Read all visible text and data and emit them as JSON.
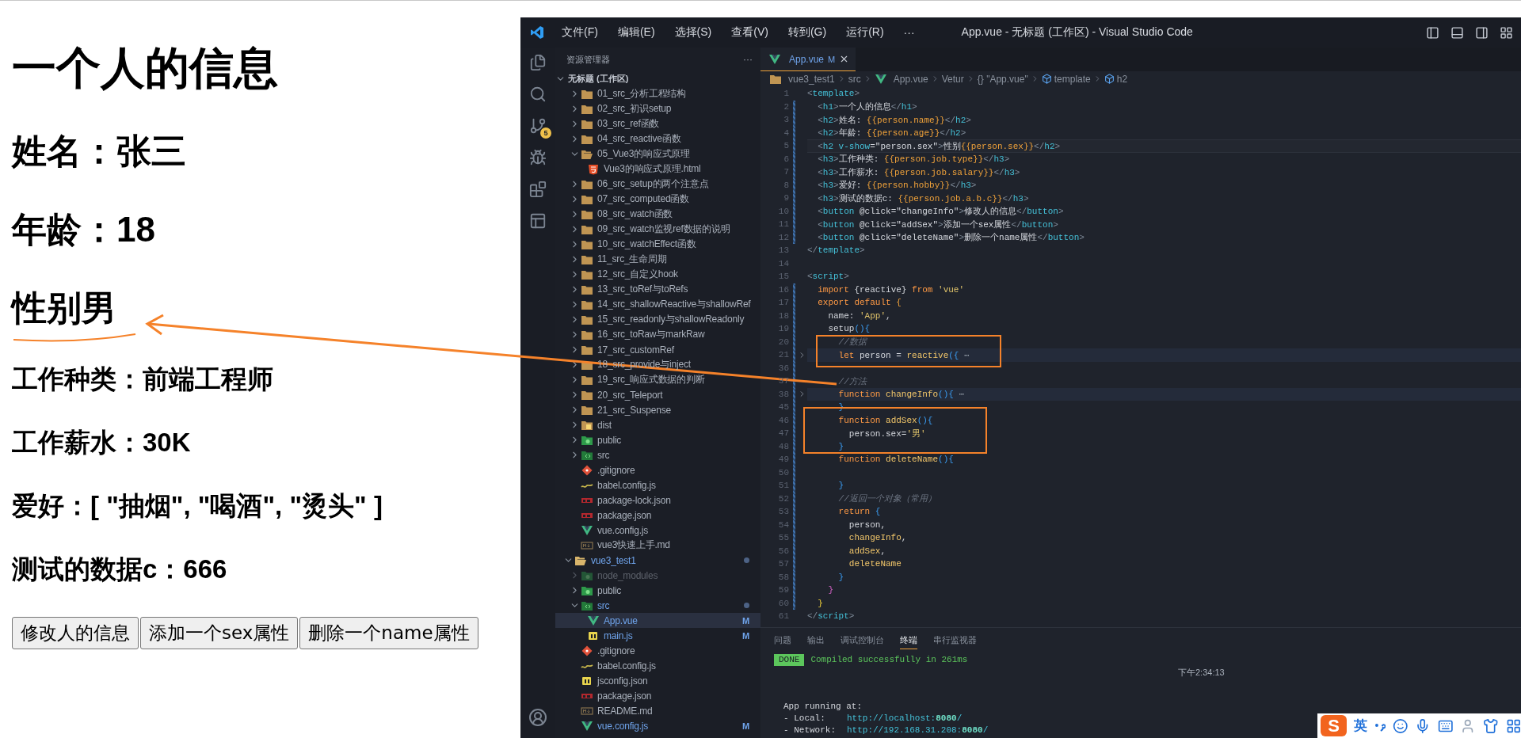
{
  "page": {
    "heading": "一个人的信息",
    "fields": [
      {
        "kind": "h2",
        "text": "姓名：张三"
      },
      {
        "kind": "h2",
        "text": "年龄：18"
      },
      {
        "kind": "h2",
        "text": "性别男"
      },
      {
        "kind": "h3",
        "text": "工作种类：前端工程师"
      },
      {
        "kind": "h3",
        "text": "工作薪水：30K"
      },
      {
        "kind": "h3",
        "text": "爱好：[ \"抽烟\", \"喝酒\", \"烫头\" ]"
      },
      {
        "kind": "h3",
        "text": "测试的数据c：666"
      }
    ],
    "buttons": [
      "修改人的信息",
      "添加一个sex属性",
      "删除一个name属性"
    ]
  },
  "vscode": {
    "title_bar": {
      "menus": [
        "文件(F)",
        "编辑(E)",
        "选择(S)",
        "查看(V)",
        "转到(G)",
        "运行(R)",
        "···"
      ],
      "title": "App.vue - 无标题 (工作区) - Visual Studio Code"
    },
    "activity_bar": {
      "scm_badge": "5"
    },
    "sidebar": {
      "title": "资源管理器",
      "more": "···",
      "workspace": {
        "label": "无标题 (工作区)",
        "expanded": true
      },
      "items": [
        {
          "label": "01_src_分析工程结构",
          "kind": "folder",
          "expanded": false,
          "selected": false,
          "modified": false,
          "ignored": false
        },
        {
          "label": "02_src_初识setup",
          "kind": "folder",
          "expanded": false,
          "selected": false,
          "modified": false,
          "ignored": false
        },
        {
          "label": "03_src_ref函数",
          "kind": "folder",
          "expanded": false,
          "selected": false,
          "modified": false,
          "ignored": false
        },
        {
          "label": "04_src_reactive函数",
          "kind": "folder",
          "expanded": false,
          "selected": false,
          "modified": false,
          "ignored": false
        },
        {
          "label": "05_Vue3的响应式原理",
          "kind": "folder",
          "expanded": true,
          "selected": false,
          "modified": false,
          "ignored": false,
          "children": [
            {
              "label": "Vue3的响应式原理.html",
              "kind": "html",
              "selected": false,
              "modified": false,
              "ignored": false
            }
          ]
        },
        {
          "label": "06_src_setup的两个注意点",
          "kind": "folder",
          "expanded": false,
          "selected": false,
          "modified": false,
          "ignored": false
        },
        {
          "label": "07_src_computed函数",
          "kind": "folder",
          "expanded": false,
          "selected": false,
          "modified": false,
          "ignored": false
        },
        {
          "label": "08_src_watch函数",
          "kind": "folder",
          "expanded": false,
          "selected": false,
          "modified": false,
          "ignored": false
        },
        {
          "label": "09_src_watch监视ref数据的说明",
          "kind": "folder",
          "expanded": false,
          "selected": false,
          "modified": false,
          "ignored": false
        },
        {
          "label": "10_src_watchEffect函数",
          "kind": "folder",
          "expanded": false,
          "selected": false,
          "modified": false,
          "ignored": false
        },
        {
          "label": "11_src_生命周期",
          "kind": "folder",
          "expanded": false,
          "selected": false,
          "modified": false,
          "ignored": false
        },
        {
          "label": "12_src_自定义hook",
          "kind": "folder",
          "expanded": false,
          "selected": false,
          "modified": false,
          "ignored": false
        },
        {
          "label": "13_src_toRef与toRefs",
          "kind": "folder",
          "expanded": false,
          "selected": false,
          "modified": false,
          "ignored": false
        },
        {
          "label": "14_src_shallowReactive与shallowRef",
          "kind": "folder",
          "expanded": false,
          "selected": false,
          "modified": false,
          "ignored": false
        },
        {
          "label": "15_src_readonly与shallowReadonly",
          "kind": "folder",
          "expanded": false,
          "selected": false,
          "modified": false,
          "ignored": false
        },
        {
          "label": "16_src_toRaw与markRaw",
          "kind": "folder",
          "expanded": false,
          "selected": false,
          "modified": false,
          "ignored": false
        },
        {
          "label": "17_src_customRef",
          "kind": "folder",
          "expanded": false,
          "selected": false,
          "modified": false,
          "ignored": false
        },
        {
          "label": "18_src_provide与inject",
          "kind": "folder",
          "expanded": false,
          "selected": false,
          "modified": false,
          "ignored": false
        },
        {
          "label": "19_src_响应式数据的判断",
          "kind": "folder",
          "expanded": false,
          "selected": false,
          "modified": false,
          "ignored": false
        },
        {
          "label": "20_src_Teleport",
          "kind": "folder",
          "expanded": false,
          "selected": false,
          "modified": false,
          "ignored": false
        },
        {
          "label": "21_src_Suspense",
          "kind": "folder",
          "expanded": false,
          "selected": false,
          "modified": false,
          "ignored": false
        },
        {
          "label": "dist",
          "kind": "dist-folder",
          "expanded": false,
          "selected": false,
          "modified": false,
          "ignored": false
        },
        {
          "label": "public",
          "kind": "public-folder",
          "expanded": false,
          "selected": false,
          "modified": false,
          "ignored": false
        },
        {
          "label": "src",
          "kind": "source-folder",
          "expanded": false,
          "selected": false,
          "modified": false,
          "ignored": false
        },
        {
          "label": ".gitignore",
          "kind": "git",
          "selected": false,
          "modified": false,
          "ignored": false
        },
        {
          "label": "babel.config.js",
          "kind": "babel",
          "selected": false,
          "modified": false,
          "ignored": false
        },
        {
          "label": "package-lock.json",
          "kind": "npm",
          "selected": false,
          "modified": false,
          "ignored": false
        },
        {
          "label": "package.json",
          "kind": "npm",
          "selected": false,
          "modified": false,
          "ignored": false
        },
        {
          "label": "vue.config.js",
          "kind": "vue",
          "selected": false,
          "modified": false,
          "ignored": false
        },
        {
          "label": "vue3快速上手.md",
          "kind": "markdown",
          "selected": false,
          "modified": false,
          "ignored": false
        },
        {
          "label": "vue3_test1",
          "kind": "root",
          "expanded": true,
          "selected": false,
          "modified": true,
          "ignored": false,
          "dot": true,
          "children": [
            {
              "label": "node_modules",
              "kind": "public-folder",
              "expanded": false,
              "selected": false,
              "modified": false,
              "ignored": true
            },
            {
              "label": "public",
              "kind": "public-folder",
              "expanded": false,
              "selected": false,
              "modified": false,
              "ignored": false
            },
            {
              "label": "src",
              "kind": "source-folder",
              "expanded": true,
              "selected": false,
              "modified": true,
              "ignored": false,
              "dot": true,
              "children": [
                {
                  "label": "App.vue",
                  "kind": "vue",
                  "selected": true,
                  "modified": true,
                  "ignored": false,
                  "badge": "M"
                },
                {
                  "label": "main.js",
                  "kind": "js",
                  "selected": false,
                  "modified": true,
                  "ignored": false,
                  "badge": "M"
                }
              ]
            },
            {
              "label": ".gitignore",
              "kind": "git",
              "selected": false,
              "modified": false,
              "ignored": false
            },
            {
              "label": "babel.config.js",
              "kind": "babel",
              "selected": false,
              "modified": false,
              "ignored": false
            },
            {
              "label": "jsconfig.json",
              "kind": "js",
              "selected": false,
              "modified": false,
              "ignored": false
            },
            {
              "label": "package.json",
              "kind": "npm",
              "selected": false,
              "modified": false,
              "ignored": false
            },
            {
              "label": "README.md",
              "kind": "markdown",
              "selected": false,
              "modified": false,
              "ignored": false
            },
            {
              "label": "vue.config.js",
              "kind": "vue",
              "selected": false,
              "modified": true,
              "ignored": false,
              "badge": "M"
            }
          ]
        }
      ]
    },
    "tabs": [
      {
        "label": "App.vue",
        "badge": "M",
        "selected": true
      }
    ],
    "breadcrumb": [
      {
        "label": "vue3_test1",
        "kind": "folder"
      },
      {
        "label": "src",
        "kind": "plain"
      },
      {
        "label": "App.vue",
        "kind": "vue"
      },
      {
        "label": "Vetur",
        "kind": "plain"
      },
      {
        "label": "{} \"App.vue\"",
        "kind": "plain"
      },
      {
        "label": "template",
        "kind": "element"
      },
      {
        "label": "h2",
        "kind": "element"
      }
    ],
    "code": [
      {
        "n": "1",
        "kind": "plain",
        "changed": false,
        "segs": [
          {
            "kind": "punct",
            "text": "<"
          },
          {
            "kind": "tag",
            "text": "template"
          },
          {
            "kind": "punct",
            "text": ">"
          }
        ]
      },
      {
        "n": "2",
        "kind": "plain",
        "changed": true,
        "segs": [
          {
            "kind": "punct",
            "text": "  <"
          },
          {
            "kind": "tag",
            "text": "h1"
          },
          {
            "kind": "punct",
            "text": ">"
          },
          {
            "kind": "text",
            "text": "一个人的信息"
          },
          {
            "kind": "punct",
            "text": "</"
          },
          {
            "kind": "tag",
            "text": "h1"
          },
          {
            "kind": "punct",
            "text": ">"
          }
        ]
      },
      {
        "n": "3",
        "kind": "plain",
        "changed": true,
        "segs": [
          {
            "kind": "punct",
            "text": "  <"
          },
          {
            "kind": "tag",
            "text": "h2"
          },
          {
            "kind": "punct",
            "text": ">"
          },
          {
            "kind": "text",
            "text": "姓名: "
          },
          {
            "kind": "interp",
            "text": "{{person.name}}"
          },
          {
            "kind": "punct",
            "text": "</"
          },
          {
            "kind": "tag",
            "text": "h2"
          },
          {
            "kind": "punct",
            "text": ">"
          }
        ]
      },
      {
        "n": "4",
        "kind": "plain",
        "changed": true,
        "segs": [
          {
            "kind": "punct",
            "text": "  <"
          },
          {
            "kind": "tag",
            "text": "h2"
          },
          {
            "kind": "punct",
            "text": ">"
          },
          {
            "kind": "text",
            "text": "年龄: "
          },
          {
            "kind": "interp",
            "text": "{{person.age}}"
          },
          {
            "kind": "punct",
            "text": "</"
          },
          {
            "kind": "tag",
            "text": "h2"
          },
          {
            "kind": "punct",
            "text": ">"
          }
        ]
      },
      {
        "n": "5",
        "kind": "current",
        "changed": true,
        "segs": [
          {
            "kind": "punct",
            "text": "  <"
          },
          {
            "kind": "tag",
            "text": "h2 v-show"
          },
          {
            "kind": "text",
            "text": "=\"person.sex\""
          },
          {
            "kind": "punct",
            "text": ">"
          },
          {
            "kind": "text",
            "text": "性别"
          },
          {
            "kind": "interp",
            "text": "{{person.sex}}"
          },
          {
            "kind": "punct",
            "text": "</"
          },
          {
            "kind": "tag",
            "text": "h2"
          },
          {
            "kind": "punct",
            "text": ">"
          }
        ]
      },
      {
        "n": "6",
        "kind": "plain",
        "changed": true,
        "segs": [
          {
            "kind": "punct",
            "text": "  <"
          },
          {
            "kind": "tag",
            "text": "h3"
          },
          {
            "kind": "punct",
            "text": ">"
          },
          {
            "kind": "text",
            "text": "工作种类: "
          },
          {
            "kind": "interp",
            "text": "{{person.job.type}}"
          },
          {
            "kind": "punct",
            "text": "</"
          },
          {
            "kind": "tag",
            "text": "h3"
          },
          {
            "kind": "punct",
            "text": ">"
          }
        ]
      },
      {
        "n": "7",
        "kind": "plain",
        "changed": true,
        "segs": [
          {
            "kind": "punct",
            "text": "  <"
          },
          {
            "kind": "tag",
            "text": "h3"
          },
          {
            "kind": "punct",
            "text": ">"
          },
          {
            "kind": "text",
            "text": "工作薪水: "
          },
          {
            "kind": "interp",
            "text": "{{person.job.salary}}"
          },
          {
            "kind": "punct",
            "text": "</"
          },
          {
            "kind": "tag",
            "text": "h3"
          },
          {
            "kind": "punct",
            "text": ">"
          }
        ]
      },
      {
        "n": "8",
        "kind": "plain",
        "changed": true,
        "segs": [
          {
            "kind": "punct",
            "text": "  <"
          },
          {
            "kind": "tag",
            "text": "h3"
          },
          {
            "kind": "punct",
            "text": ">"
          },
          {
            "kind": "text",
            "text": "爱好: "
          },
          {
            "kind": "interp",
            "text": "{{person.hobby}}"
          },
          {
            "kind": "punct",
            "text": "</"
          },
          {
            "kind": "tag",
            "text": "h3"
          },
          {
            "kind": "punct",
            "text": ">"
          }
        ]
      },
      {
        "n": "9",
        "kind": "plain",
        "changed": true,
        "segs": [
          {
            "kind": "punct",
            "text": "  <"
          },
          {
            "kind": "tag",
            "text": "h3"
          },
          {
            "kind": "punct",
            "text": ">"
          },
          {
            "kind": "text",
            "text": "测试的数据c: "
          },
          {
            "kind": "interp",
            "text": "{{person.job.a.b.c}}"
          },
          {
            "kind": "punct",
            "text": "</"
          },
          {
            "kind": "tag",
            "text": "h3"
          },
          {
            "kind": "punct",
            "text": ">"
          }
        ]
      },
      {
        "n": "10",
        "kind": "plain",
        "changed": true,
        "segs": [
          {
            "kind": "punct",
            "text": "  <"
          },
          {
            "kind": "tag",
            "text": "button"
          },
          {
            "kind": "text",
            "text": " @click=\"changeInfo\""
          },
          {
            "kind": "punct",
            "text": ">"
          },
          {
            "kind": "text",
            "text": "修改人的信息"
          },
          {
            "kind": "punct",
            "text": "</"
          },
          {
            "kind": "tag",
            "text": "button"
          },
          {
            "kind": "punct",
            "text": ">"
          }
        ]
      },
      {
        "n": "11",
        "kind": "plain",
        "changed": true,
        "segs": [
          {
            "kind": "punct",
            "text": "  <"
          },
          {
            "kind": "tag",
            "text": "button"
          },
          {
            "kind": "text",
            "text": " @click=\"addSex\""
          },
          {
            "kind": "punct",
            "text": ">"
          },
          {
            "kind": "text",
            "text": "添加一个sex属性"
          },
          {
            "kind": "punct",
            "text": "</"
          },
          {
            "kind": "tag",
            "text": "button"
          },
          {
            "kind": "punct",
            "text": ">"
          }
        ]
      },
      {
        "n": "12",
        "kind": "plain",
        "changed": true,
        "segs": [
          {
            "kind": "punct",
            "text": "  <"
          },
          {
            "kind": "tag",
            "text": "button"
          },
          {
            "kind": "text",
            "text": " @click=\"deleteName\""
          },
          {
            "kind": "punct",
            "text": ">"
          },
          {
            "kind": "text",
            "text": "删除一个name属性"
          },
          {
            "kind": "punct",
            "text": "</"
          },
          {
            "kind": "tag",
            "text": "button"
          },
          {
            "kind": "punct",
            "text": ">"
          }
        ]
      },
      {
        "n": "13",
        "kind": "plain",
        "changed": false,
        "segs": [
          {
            "kind": "punct",
            "text": "</"
          },
          {
            "kind": "tag",
            "text": "template"
          },
          {
            "kind": "punct",
            "text": ">"
          }
        ]
      },
      {
        "n": "14",
        "kind": "plain",
        "changed": false
      },
      {
        "n": "15",
        "kind": "plain",
        "changed": false,
        "segs": [
          {
            "kind": "punct",
            "text": "<"
          },
          {
            "kind": "tag",
            "text": "script"
          },
          {
            "kind": "punct",
            "text": ">"
          }
        ]
      },
      {
        "n": "16",
        "kind": "plain",
        "changed": true,
        "segs": [
          {
            "kind": "kw",
            "text": "  import "
          },
          {
            "kind": "text",
            "text": "{reactive} "
          },
          {
            "kind": "kw",
            "text": "from "
          },
          {
            "kind": "string",
            "text": "'vue'"
          }
        ]
      },
      {
        "n": "17",
        "kind": "plain",
        "changed": true,
        "segs": [
          {
            "kind": "kw",
            "text": "  export default "
          },
          {
            "kind": "interp",
            "text": "{"
          }
        ]
      },
      {
        "n": "18",
        "kind": "plain",
        "changed": true,
        "segs": [
          {
            "kind": "text",
            "text": "    name: "
          },
          {
            "kind": "string",
            "text": "'App'"
          },
          {
            "kind": "text",
            "text": ","
          }
        ]
      },
      {
        "n": "19",
        "kind": "plain",
        "changed": true,
        "segs": [
          {
            "kind": "text",
            "text": "    setup"
          },
          {
            "kind": "bracket",
            "text": "(){"
          }
        ]
      },
      {
        "n": "20",
        "kind": "plain",
        "changed": true,
        "segs": [
          {
            "kind": "comment",
            "text": "      //数据"
          }
        ]
      },
      {
        "n": "21",
        "kind": "folded",
        "changed": true,
        "segs": [
          {
            "kind": "kw",
            "text": "      let "
          },
          {
            "kind": "text",
            "text": "person = "
          },
          {
            "kind": "fn",
            "text": "reactive"
          },
          {
            "kind": "bracket",
            "text": "({"
          },
          {
            "kind": "fold",
            "text": " ⋯"
          }
        ]
      },
      {
        "n": "36",
        "kind": "plain",
        "changed": true
      },
      {
        "n": "37",
        "kind": "plain",
        "changed": true,
        "segs": [
          {
            "kind": "comment",
            "text": "      //方法"
          }
        ]
      },
      {
        "n": "38",
        "kind": "folded",
        "changed": true,
        "segs": [
          {
            "kind": "kw",
            "text": "      function "
          },
          {
            "kind": "fn",
            "text": "changeInfo"
          },
          {
            "kind": "bracket",
            "text": "(){"
          },
          {
            "kind": "fold",
            "text": " ⋯"
          }
        ]
      },
      {
        "n": "45",
        "kind": "plain",
        "changed": true,
        "segs": [
          {
            "kind": "bracket",
            "text": "      }"
          }
        ]
      },
      {
        "n": "46",
        "kind": "plain",
        "changed": true,
        "segs": [
          {
            "kind": "kw",
            "text": "      function "
          },
          {
            "kind": "fn",
            "text": "addSex"
          },
          {
            "kind": "bracket",
            "text": "(){"
          }
        ]
      },
      {
        "n": "47",
        "kind": "plain",
        "changed": true,
        "segs": [
          {
            "kind": "text",
            "text": "        person.sex="
          },
          {
            "kind": "string",
            "text": "'男'"
          }
        ]
      },
      {
        "n": "48",
        "kind": "plain",
        "changed": true,
        "segs": [
          {
            "kind": "bracket",
            "text": "      }"
          }
        ]
      },
      {
        "n": "49",
        "kind": "plain",
        "changed": true,
        "segs": [
          {
            "kind": "kw",
            "text": "      function "
          },
          {
            "kind": "fn",
            "text": "deleteName"
          },
          {
            "kind": "bracket",
            "text": "(){"
          }
        ]
      },
      {
        "n": "50",
        "kind": "plain",
        "changed": true
      },
      {
        "n": "51",
        "kind": "plain",
        "changed": true,
        "segs": [
          {
            "kind": "bracket",
            "text": "      }"
          }
        ]
      },
      {
        "n": "52",
        "kind": "plain",
        "changed": true,
        "segs": [
          {
            "kind": "comment",
            "text": "      //返回一个对象（常用）"
          }
        ]
      },
      {
        "n": "53",
        "kind": "plain",
        "changed": true,
        "segs": [
          {
            "kind": "kw",
            "text": "      return "
          },
          {
            "kind": "bracket",
            "text": "{"
          }
        ]
      },
      {
        "n": "54",
        "kind": "plain",
        "changed": true,
        "segs": [
          {
            "kind": "text",
            "text": "        person,"
          }
        ]
      },
      {
        "n": "55",
        "kind": "plain",
        "changed": true,
        "segs": [
          {
            "kind": "fn",
            "text": "        changeInfo"
          },
          {
            "kind": "text",
            "text": ","
          }
        ]
      },
      {
        "n": "56",
        "kind": "plain",
        "changed": true,
        "segs": [
          {
            "kind": "fn",
            "text": "        addSex"
          },
          {
            "kind": "text",
            "text": ","
          }
        ]
      },
      {
        "n": "57",
        "kind": "plain",
        "changed": true,
        "segs": [
          {
            "kind": "fn",
            "text": "        deleteName"
          }
        ]
      },
      {
        "n": "58",
        "kind": "plain",
        "changed": true,
        "segs": [
          {
            "kind": "bracket",
            "text": "      }"
          }
        ]
      },
      {
        "n": "59",
        "kind": "plain",
        "changed": true,
        "segs": [
          {
            "kind": "bracket2",
            "text": "    }"
          }
        ]
      },
      {
        "n": "60",
        "kind": "plain",
        "changed": true,
        "segs": [
          {
            "kind": "bracket3",
            "text": "  }"
          }
        ]
      },
      {
        "n": "61",
        "kind": "plain",
        "changed": false,
        "segs": [
          {
            "kind": "punct",
            "text": "</"
          },
          {
            "kind": "tag",
            "text": "script"
          },
          {
            "kind": "punct",
            "text": ">"
          }
        ]
      }
    ],
    "panel": {
      "tabs": [
        {
          "label": "问题",
          "selected": false
        },
        {
          "label": "输出",
          "selected": false
        },
        {
          "label": "调试控制台",
          "selected": false
        },
        {
          "label": "终端",
          "selected": true
        },
        {
          "label": "串行监视器",
          "selected": false
        }
      ],
      "terminal": {
        "status": "DONE",
        "message": "Compiled successfully in 261ms",
        "time": "下午2:34:13",
        "heading": "App running at:",
        "urls": [
          {
            "label": "- Local:",
            "url": "http://localhost:**8080**/"
          },
          {
            "label": "- Network:",
            "url": "http://192.168.31.208:**8080**/"
          }
        ]
      }
    }
  },
  "ime_bar": {
    "logo": "S",
    "mode": "英"
  }
}
